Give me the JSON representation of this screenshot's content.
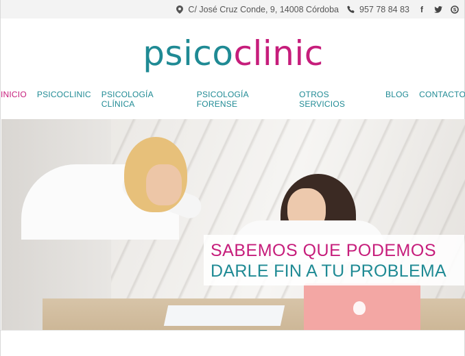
{
  "topbar": {
    "address": "C/ José Cruz Conde, 9, 14008 Córdoba",
    "phone": "957 78 84 83",
    "icons": [
      "map-marker-icon",
      "phone-icon",
      "facebook-icon",
      "twitter-icon",
      "skype-icon"
    ]
  },
  "logo": {
    "part1": "psico",
    "part2": "clinic"
  },
  "nav": {
    "items": [
      "INICIO",
      "PSICOCLINIC",
      "PSICOLOGÍA CLÍNICA",
      "PSICOLOGÍA FORENSE",
      "OTROS SERVICIOS",
      "BLOG",
      "CONTACTO"
    ],
    "active": "INICIO"
  },
  "hero": {
    "line1": "SABEMOS QUE PODEMOS",
    "line2": "DARLE FIN A TU PROBLEMA"
  },
  "colors": {
    "teal": "#1f8a94",
    "magenta": "#c61d7b"
  }
}
